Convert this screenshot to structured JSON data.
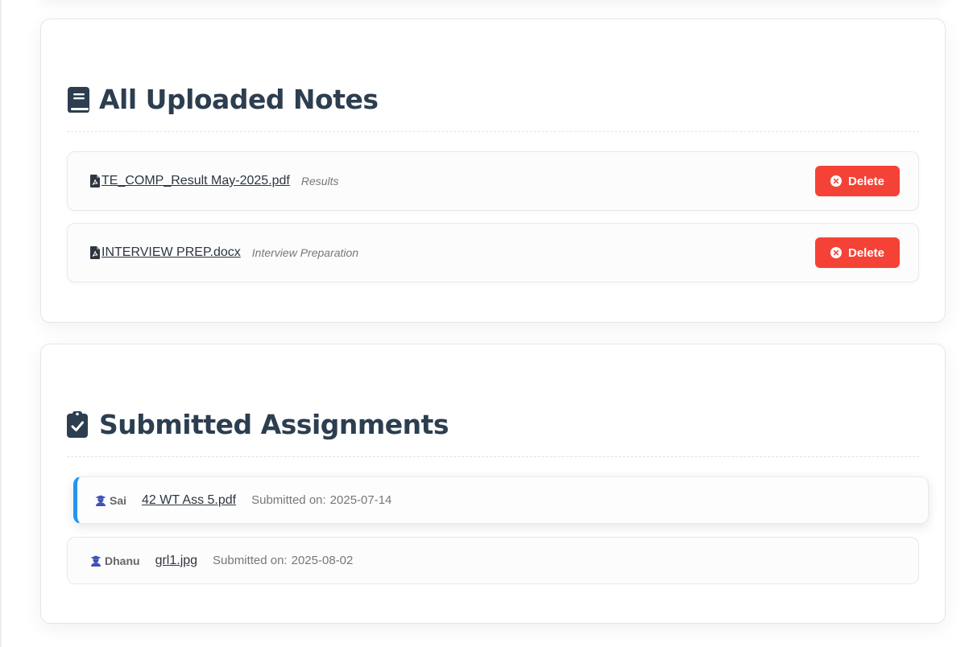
{
  "notes_section": {
    "title": "All Uploaded Notes",
    "title_icon": "book-icon",
    "items": [
      {
        "file_name": "TE_COMP_Result May-2025.pdf",
        "category": "Results",
        "delete_label": "Delete"
      },
      {
        "file_name": "INTERVIEW PREP.docx",
        "category": "Interview Preparation",
        "delete_label": "Delete"
      }
    ]
  },
  "assignments_section": {
    "title": "Submitted Assignments",
    "title_icon": "clipboard-check-icon",
    "submitted_label": "Submitted on:",
    "items": [
      {
        "student": "Sai",
        "file_name": "42 WT Ass 5.pdf",
        "date": "2025-07-14"
      },
      {
        "student": "Dhanu",
        "file_name": "grl1.jpg",
        "date": "2025-08-02"
      }
    ]
  },
  "colors": {
    "heading": "#2c3e50",
    "delete": "#f44336",
    "active_accent": "#2196f3",
    "student_icon": "#3f51b5"
  }
}
